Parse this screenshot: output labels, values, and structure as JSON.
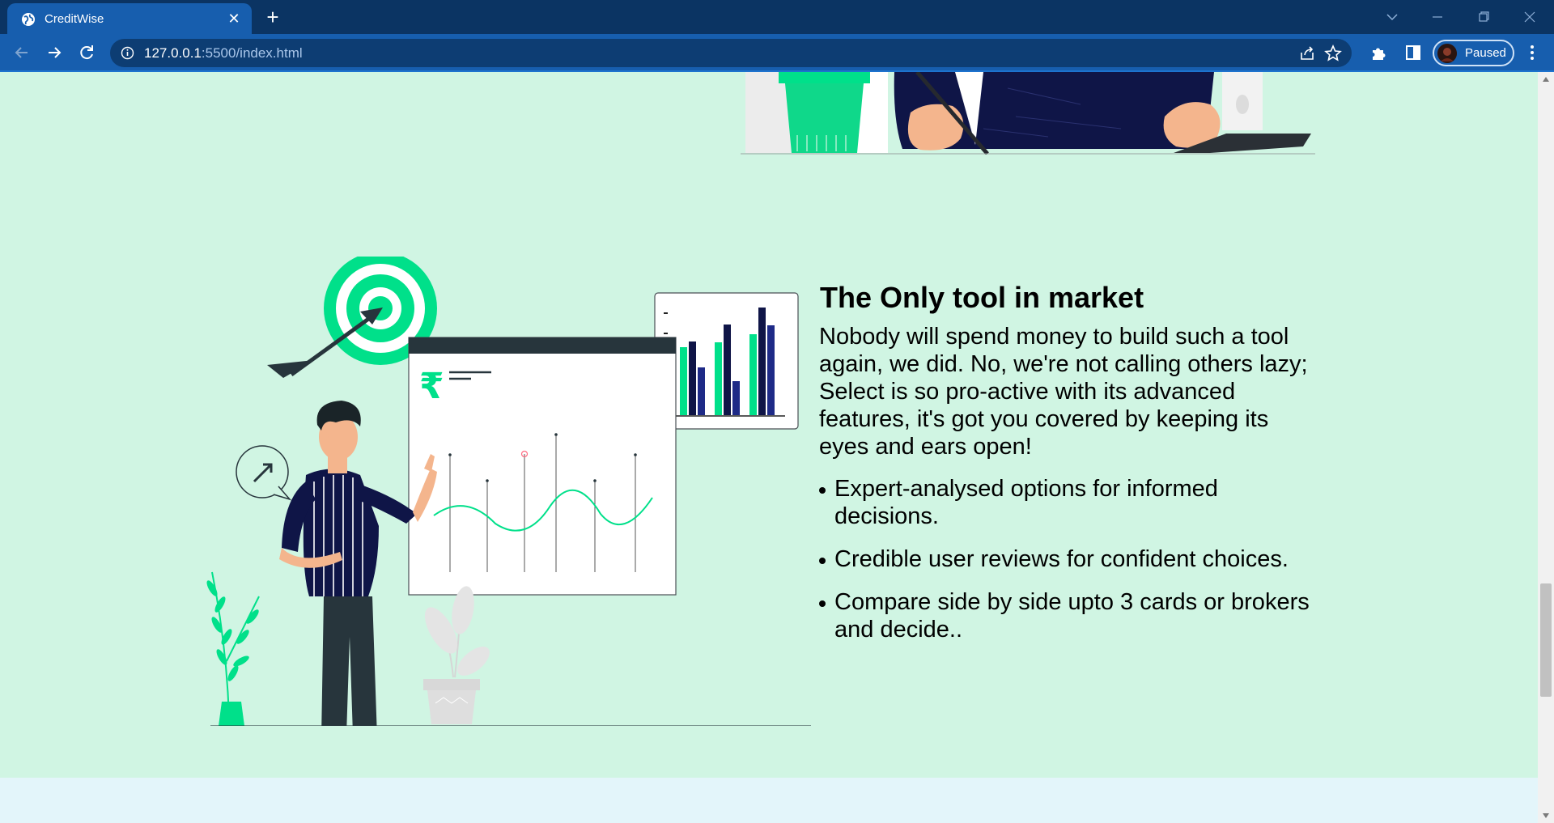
{
  "browser": {
    "tab_title": "CreditWise",
    "url_host": "127.0.0.1",
    "url_rest": ":5500/index.html",
    "profile_status": "Paused",
    "icons": [
      "globe-icon",
      "close-icon",
      "plus-icon",
      "back-arrow-icon",
      "forward-arrow-icon",
      "reload-icon",
      "info-icon",
      "share-icon",
      "star-icon",
      "puzzle-icon",
      "side-panel-icon",
      "kebab-menu-icon",
      "minimize-icon",
      "restore-icon",
      "window-close-icon",
      "chevron-down-icon"
    ]
  },
  "feature": {
    "heading": "The Only tool in market",
    "description": "Nobody will spend money to build such a tool again, we did. No, we're not calling others lazy; Select is so pro-active with its advanced features, it's got you covered by keeping its eyes and ears open!",
    "points": [
      "Expert-analysed options for informed decisions.",
      "Credible user reviews for confident choices.",
      "Compare side by side upto 3 cards or brokers and decide.."
    ]
  },
  "illustration": {
    "currency_symbol": "₹"
  },
  "colors": {
    "page_bg": "#d0f5e3",
    "accent_green": "#00e08a",
    "navy": "#0f1547",
    "tabbar_bg": "#0b3463",
    "toolbar_bg": "#175eae",
    "bottom_band": "#e3f5fa"
  }
}
